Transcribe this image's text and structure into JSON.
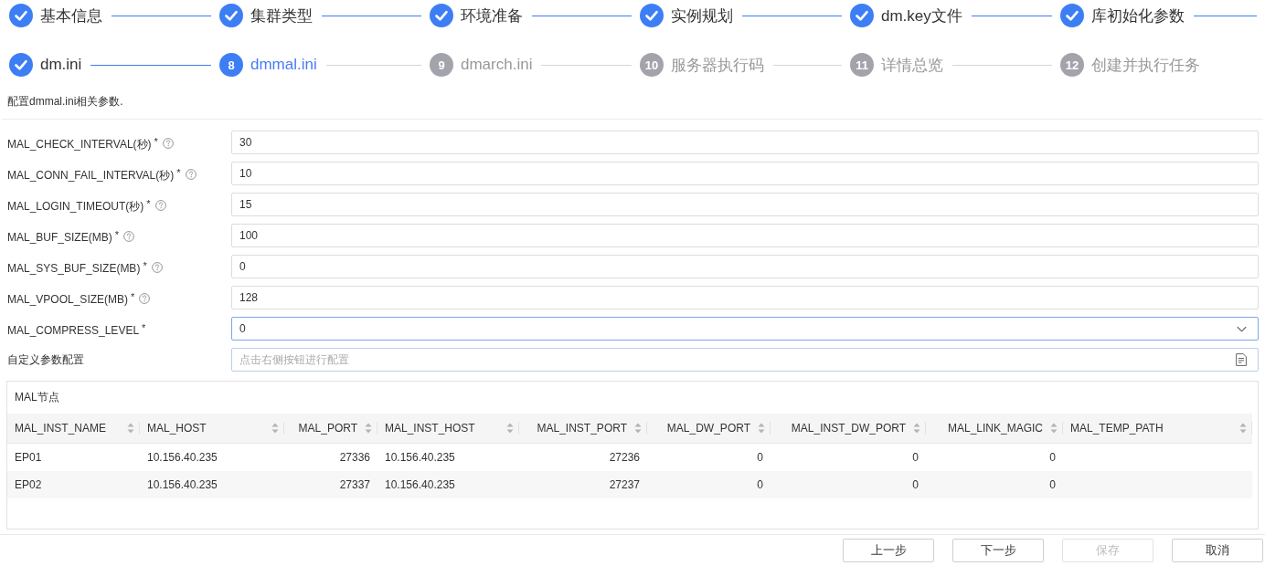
{
  "steps": [
    {
      "label": "基本信息",
      "done": true,
      "active": false
    },
    {
      "label": "集群类型",
      "done": true,
      "active": false
    },
    {
      "label": "环境准备",
      "done": true,
      "active": false
    },
    {
      "label": "实例规划",
      "done": true,
      "active": false
    },
    {
      "label": "dm.key文件",
      "done": true,
      "active": false
    },
    {
      "label": "库初始化参数",
      "done": true,
      "active": false
    },
    {
      "label": "dm.ini",
      "done": true,
      "active": false
    },
    {
      "number": "8",
      "label": "dmmal.ini",
      "done": false,
      "active": true
    },
    {
      "number": "9",
      "label": "dmarch.ini",
      "done": false,
      "active": false
    },
    {
      "number": "10",
      "label": "服务器执行码",
      "done": false,
      "active": false
    },
    {
      "number": "11",
      "label": "详情总览",
      "done": false,
      "active": false
    },
    {
      "number": "12",
      "label": "创建并执行任务",
      "done": false,
      "active": false
    }
  ],
  "description": "配置dmmal.ini相关参数.",
  "fields": [
    {
      "label": "MAL_CHECK_INTERVAL(秒)",
      "required_mark": "*",
      "help": true,
      "kind": "input",
      "value": "30",
      "focused": false
    },
    {
      "label": "MAL_CONN_FAIL_INTERVAL(秒)",
      "required_mark": "*",
      "help": true,
      "kind": "input",
      "value": "10",
      "focused": false
    },
    {
      "label": "MAL_LOGIN_TIMEOUT(秒)",
      "required_mark": "*",
      "help": true,
      "kind": "input",
      "value": "15",
      "focused": false
    },
    {
      "label": "MAL_BUF_SIZE(MB)",
      "required_mark": "*",
      "help": true,
      "kind": "input",
      "value": "100",
      "focused": false
    },
    {
      "label": "MAL_SYS_BUF_SIZE(MB)",
      "required_mark": "*",
      "help": true,
      "kind": "input",
      "value": "0",
      "focused": false
    },
    {
      "label": "MAL_VPOOL_SIZE(MB)",
      "required_mark": "*",
      "help": true,
      "kind": "input",
      "value": "128",
      "focused": false
    },
    {
      "label": "MAL_COMPRESS_LEVEL",
      "required_mark": "*",
      "help": false,
      "kind": "select",
      "value": "0",
      "focused": true
    },
    {
      "label": "自定义参数配置",
      "help": false,
      "kind": "picker",
      "placeholder": "点击右侧按钮进行配置",
      "focused": false
    }
  ],
  "table": {
    "title": "MAL节点",
    "columns": [
      {
        "title": "MAL_INST_NAME",
        "kind": "text"
      },
      {
        "title": "MAL_HOST",
        "kind": "text"
      },
      {
        "title": "MAL_PORT",
        "kind": "number"
      },
      {
        "title": "MAL_INST_HOST",
        "kind": "text"
      },
      {
        "title": "MAL_INST_PORT",
        "kind": "number"
      },
      {
        "title": "MAL_DW_PORT",
        "kind": "number"
      },
      {
        "title": "MAL_INST_DW_PORT",
        "kind": "number"
      },
      {
        "title": "MAL_LINK_MAGIC",
        "kind": "number"
      },
      {
        "title": "MAL_TEMP_PATH",
        "kind": "text"
      }
    ],
    "rows": [
      {
        "cells": [
          "EP01",
          "10.156.40.235",
          "27336",
          "10.156.40.235",
          "27236",
          "0",
          "0",
          "0"
        ]
      },
      {
        "cells": [
          "EP02",
          "10.156.40.235",
          "27337",
          "10.156.40.235",
          "27237",
          "0",
          "0",
          "0"
        ]
      }
    ]
  },
  "buttons": [
    {
      "label": "上一步",
      "disabled": false
    },
    {
      "label": "下一步",
      "disabled": false
    },
    {
      "label": "保存",
      "disabled": true
    },
    {
      "label": "取消",
      "disabled": false
    }
  ]
}
